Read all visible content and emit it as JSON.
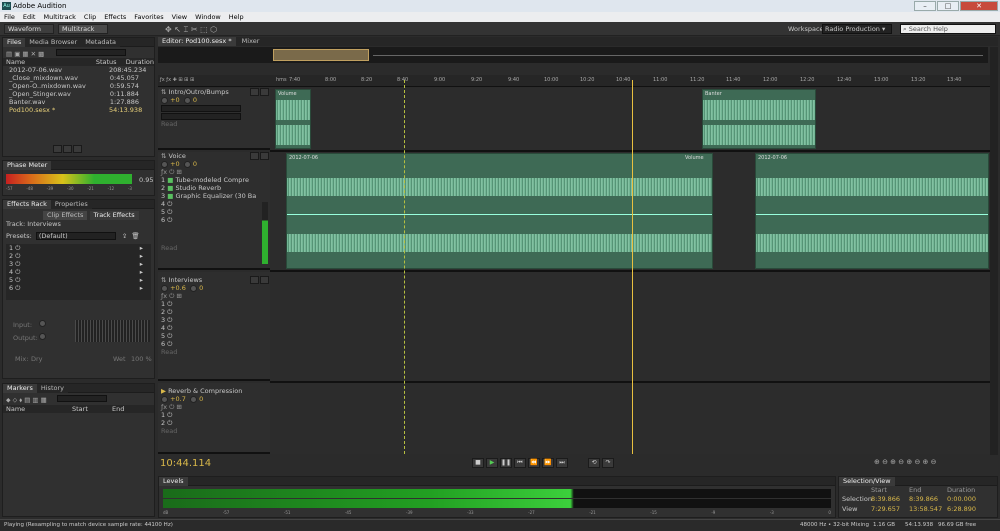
{
  "app": {
    "title": "Adobe Audition",
    "logo": "Au"
  },
  "menu": [
    "File",
    "Edit",
    "Multitrack",
    "Clip",
    "Effects",
    "Favorites",
    "View",
    "Window",
    "Help"
  ],
  "toolbar": {
    "waveform": "Waveform",
    "multitrack": "Multitrack",
    "workspace_label": "Workspace:",
    "workspace": "Radio Production",
    "search_placeholder": "Search Help"
  },
  "files": {
    "tabs": [
      "Files",
      "Media Browser",
      "Metadata"
    ],
    "headers": {
      "name": "Name",
      "status": "Status",
      "duration": "Duration"
    },
    "items": [
      {
        "name": "2012-07-06.wav",
        "dur": "208:45.234"
      },
      {
        "name": "_Close_mixdown.wav",
        "dur": "0:45.057"
      },
      {
        "name": "_Open-O..mixdown.wav",
        "dur": "0:59.574"
      },
      {
        "name": "_Open_Stinger.wav",
        "dur": "0:11.884"
      },
      {
        "name": "Banter.wav",
        "dur": "1:27.886"
      },
      {
        "name": "Pod100.sesx *",
        "dur": "54:13.938"
      }
    ]
  },
  "phase": {
    "title": "Phase Meter",
    "scale": [
      "-57",
      "-54",
      "-51",
      "-48",
      "-45",
      "-42",
      "-39",
      "-36",
      "-33",
      "-30",
      "-27",
      "-24",
      "-21",
      "-18",
      "-15",
      "-12",
      "-9",
      "-6",
      "-3",
      "0"
    ],
    "value": "0.95"
  },
  "fxrack": {
    "tabs": [
      "Effects Rack",
      "Properties"
    ],
    "subtabs": [
      "Clip Effects",
      "Track Effects"
    ],
    "track": "Track: Interviews",
    "presets_label": "Presets:",
    "preset": "(Default)",
    "slots": [
      "1",
      "2",
      "3",
      "4",
      "5",
      "6"
    ],
    "input": "Input:",
    "output": "Output:",
    "mix": "Mix:",
    "dry": "Dry",
    "wet": "Wet",
    "pct": "100 %"
  },
  "markers": {
    "tabs": [
      "Markers",
      "History"
    ],
    "headers": [
      "Name",
      "Start",
      "End"
    ]
  },
  "editor": {
    "tab": "Editor: Pod100.sesx *",
    "mixer": "Mixer"
  },
  "ruler": {
    "labels": [
      "hms",
      "7:40",
      "8:00",
      "8:20",
      "8:40",
      "9:00",
      "9:20",
      "9:40",
      "10:00",
      "10:20",
      "10:40",
      "11:00",
      "11:20",
      "11:40",
      "12:00",
      "12:20",
      "12:40",
      "13:00",
      "13:20",
      "13:40"
    ]
  },
  "tracks": [
    {
      "name": "Intro/Outro/Bumps",
      "vol": "+0",
      "pan": "0",
      "read": "Read",
      "clips": [
        {
          "label": "Volume"
        },
        {
          "label": "Banter"
        }
      ]
    },
    {
      "name": "Voice",
      "vol": "+0",
      "pan": "0",
      "read": "Read",
      "fx": [
        "Tube-modeled Compre",
        "Studio Reverb",
        "Graphic Equalizer (30 Ba"
      ],
      "clips": [
        {
          "label": "2012-07-06",
          "vol": "Volume"
        },
        {
          "label": "2012-07-06"
        }
      ]
    },
    {
      "name": "Interviews",
      "vol": "+0.6",
      "pan": "0",
      "read": "Read"
    },
    {
      "name": "Reverb & Compression",
      "vol": "+0.7",
      "pan": "0",
      "read": "Read"
    }
  ],
  "time": "10:44.114",
  "levels": {
    "title": "Levels",
    "scale": [
      "dB",
      "-57",
      "-54",
      "-51",
      "-48",
      "-45",
      "-42",
      "-39",
      "-36",
      "-33",
      "-30",
      "-27",
      "-24",
      "-21",
      "-18",
      "-15",
      "-12",
      "-9",
      "-6",
      "-3",
      "0"
    ]
  },
  "selection": {
    "title": "Selection/View",
    "headers": [
      "Start",
      "End",
      "Duration"
    ],
    "rows": [
      {
        "label": "Selection",
        "start": "8:39.866",
        "end": "8:39.866",
        "dur": "0:00.000"
      },
      {
        "label": "View",
        "start": "7:29.657",
        "end": "13:58.547",
        "dur": "6:28.890"
      }
    ]
  },
  "status": {
    "text": "Playing (Resampling to match device sample rate: 44100 Hz)",
    "rate": "48000 Hz • 32-bit Mixing",
    "mem": "1.16 GB",
    "dur": "54:13.938",
    "free": "96.69 GB free"
  }
}
